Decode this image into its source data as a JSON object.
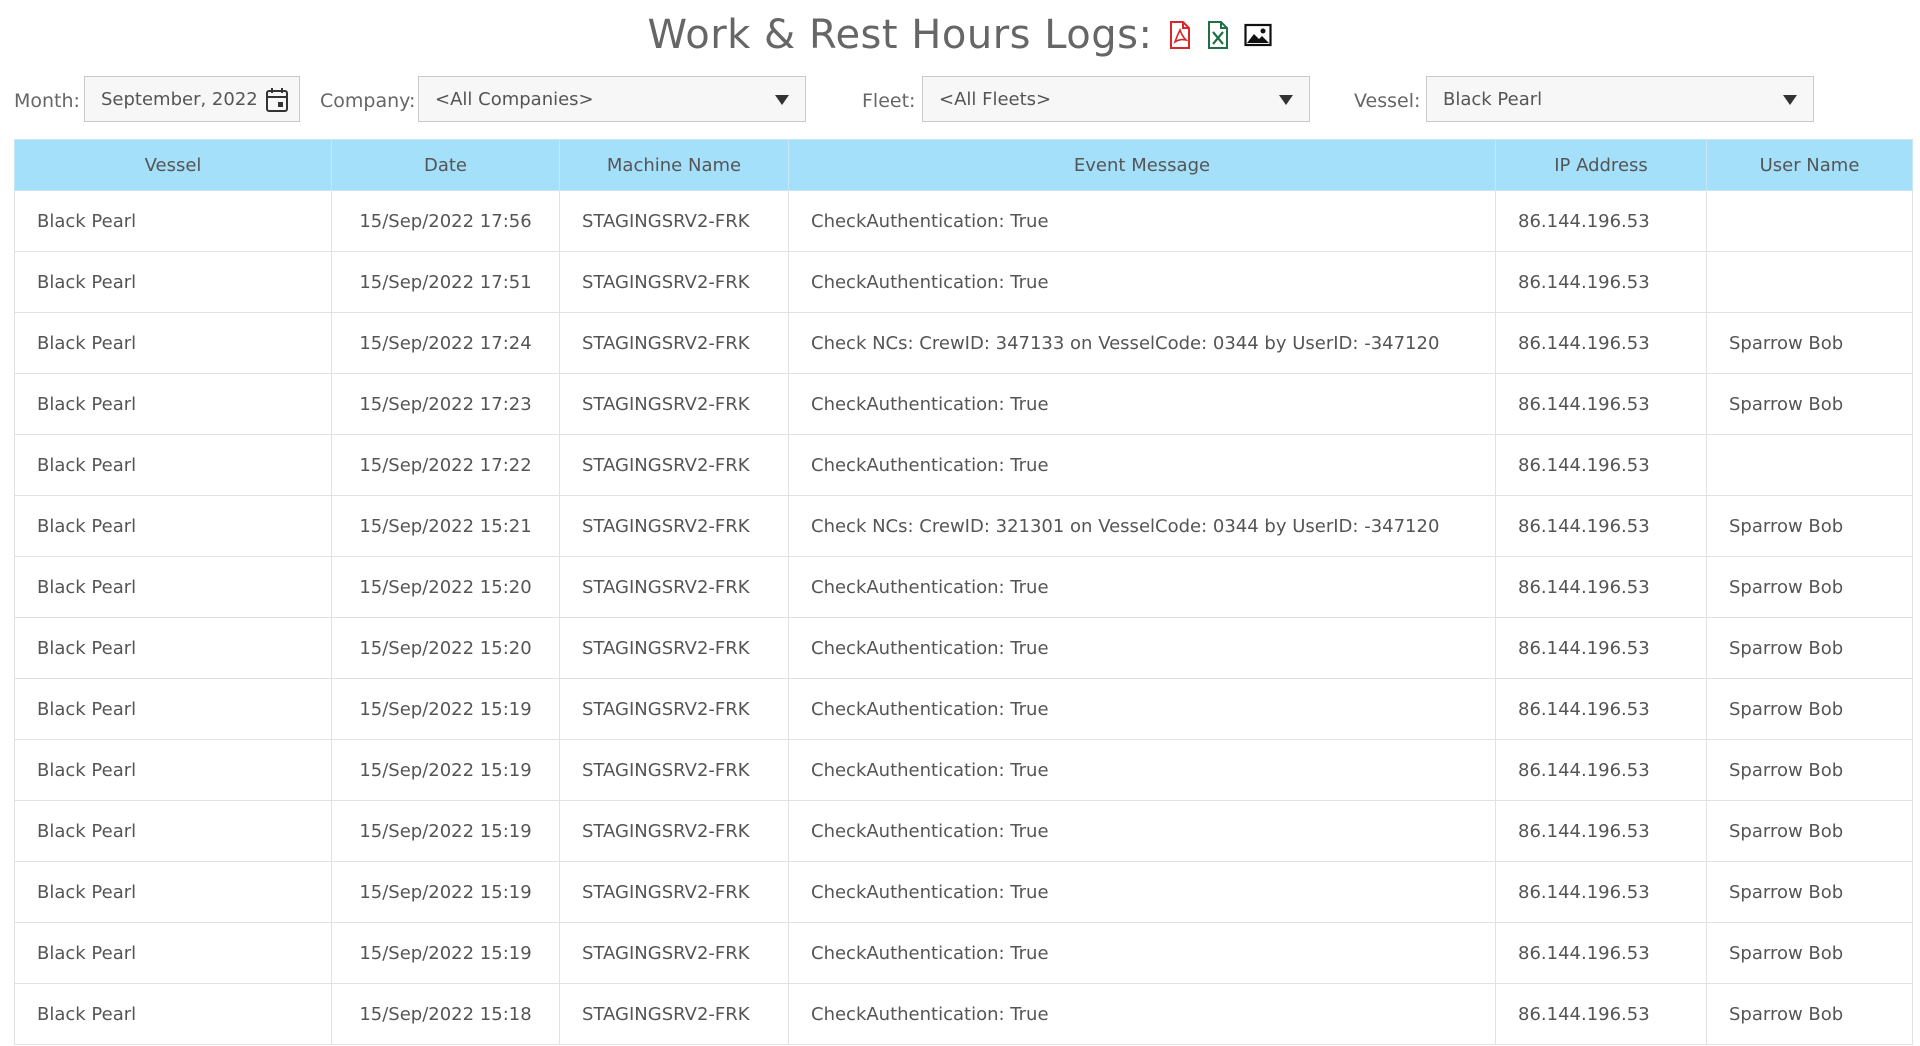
{
  "header": {
    "title": "Work & Rest Hours Logs:",
    "icons": [
      "pdf-export-icon",
      "excel-export-icon",
      "image-export-icon"
    ],
    "colors": {
      "pdf": "#d9262b",
      "excel": "#1e7145",
      "image": "#111111"
    }
  },
  "filters": {
    "month_label": "Month:",
    "month_value": "September, 2022",
    "company_label": "Company:",
    "company_value": "<All Companies>",
    "fleet_label": "Fleet:",
    "fleet_value": "<All Fleets>",
    "vessel_label": "Vessel:",
    "vessel_value": "Black Pearl"
  },
  "table": {
    "header_color": "#a5e0fb",
    "columns": [
      "Vessel",
      "Date",
      "Machine Name",
      "Event Message",
      "IP Address",
      "User Name"
    ],
    "rows": [
      {
        "vessel": "Black Pearl",
        "date": "15/Sep/2022 17:56",
        "machine": "STAGINGSRV2-FRK",
        "message": "CheckAuthentication: True",
        "ip": "86.144.196.53",
        "user": ""
      },
      {
        "vessel": "Black Pearl",
        "date": "15/Sep/2022 17:51",
        "machine": "STAGINGSRV2-FRK",
        "message": "CheckAuthentication: True",
        "ip": "86.144.196.53",
        "user": ""
      },
      {
        "vessel": "Black Pearl",
        "date": "15/Sep/2022 17:24",
        "machine": "STAGINGSRV2-FRK",
        "message": "Check NCs: CrewID: 347133 on VesselCode: 0344 by UserID: -347120",
        "ip": "86.144.196.53",
        "user": "Sparrow Bob"
      },
      {
        "vessel": "Black Pearl",
        "date": "15/Sep/2022 17:23",
        "machine": "STAGINGSRV2-FRK",
        "message": "CheckAuthentication: True",
        "ip": "86.144.196.53",
        "user": "Sparrow Bob"
      },
      {
        "vessel": "Black Pearl",
        "date": "15/Sep/2022 17:22",
        "machine": "STAGINGSRV2-FRK",
        "message": "CheckAuthentication: True",
        "ip": "86.144.196.53",
        "user": ""
      },
      {
        "vessel": "Black Pearl",
        "date": "15/Sep/2022 15:21",
        "machine": "STAGINGSRV2-FRK",
        "message": "Check NCs: CrewID: 321301 on VesselCode: 0344 by UserID: -347120",
        "ip": "86.144.196.53",
        "user": "Sparrow Bob"
      },
      {
        "vessel": "Black Pearl",
        "date": "15/Sep/2022 15:20",
        "machine": "STAGINGSRV2-FRK",
        "message": "CheckAuthentication: True",
        "ip": "86.144.196.53",
        "user": "Sparrow Bob"
      },
      {
        "vessel": "Black Pearl",
        "date": "15/Sep/2022 15:20",
        "machine": "STAGINGSRV2-FRK",
        "message": "CheckAuthentication: True",
        "ip": "86.144.196.53",
        "user": "Sparrow Bob"
      },
      {
        "vessel": "Black Pearl",
        "date": "15/Sep/2022 15:19",
        "machine": "STAGINGSRV2-FRK",
        "message": "CheckAuthentication: True",
        "ip": "86.144.196.53",
        "user": "Sparrow Bob"
      },
      {
        "vessel": "Black Pearl",
        "date": "15/Sep/2022 15:19",
        "machine": "STAGINGSRV2-FRK",
        "message": "CheckAuthentication: True",
        "ip": "86.144.196.53",
        "user": "Sparrow Bob"
      },
      {
        "vessel": "Black Pearl",
        "date": "15/Sep/2022 15:19",
        "machine": "STAGINGSRV2-FRK",
        "message": "CheckAuthentication: True",
        "ip": "86.144.196.53",
        "user": "Sparrow Bob"
      },
      {
        "vessel": "Black Pearl",
        "date": "15/Sep/2022 15:19",
        "machine": "STAGINGSRV2-FRK",
        "message": "CheckAuthentication: True",
        "ip": "86.144.196.53",
        "user": "Sparrow Bob"
      },
      {
        "vessel": "Black Pearl",
        "date": "15/Sep/2022 15:19",
        "machine": "STAGINGSRV2-FRK",
        "message": "CheckAuthentication: True",
        "ip": "86.144.196.53",
        "user": "Sparrow Bob"
      },
      {
        "vessel": "Black Pearl",
        "date": "15/Sep/2022 15:18",
        "machine": "STAGINGSRV2-FRK",
        "message": "CheckAuthentication: True",
        "ip": "86.144.196.53",
        "user": "Sparrow Bob"
      }
    ]
  }
}
